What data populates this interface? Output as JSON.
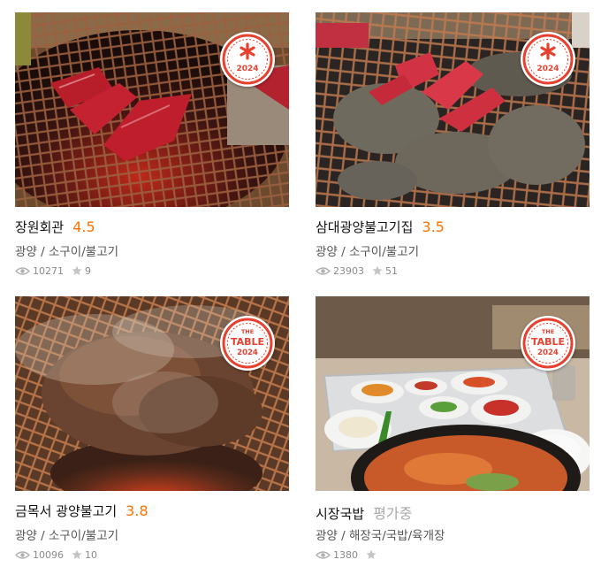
{
  "restaurants": [
    {
      "name": "장원회관",
      "rating": "4.5",
      "category": "광양 / 소구이/불고기",
      "views": "10271",
      "favorites": "9",
      "badge_text": "2024",
      "badge_icon": "asterisk-icon"
    },
    {
      "name": "삼대광양불고기집",
      "rating": "3.5",
      "category": "광양 / 소구이/불고기",
      "views": "23903",
      "favorites": "51",
      "badge_text": "2024",
      "badge_icon": "asterisk-icon"
    },
    {
      "name": "금목서 광양불고기",
      "rating": "3.8",
      "category": "광양 / 소구이/불고기",
      "views": "10096",
      "favorites": "10",
      "badge_top": "THE",
      "badge_main": "TABLE",
      "badge_year": "2024"
    },
    {
      "name": "시장국밥",
      "rating": "평가중",
      "category": "광양 / 해장국/국밥/육개장",
      "views": "1380",
      "favorites": "",
      "badge_top": "THE",
      "badge_main": "TABLE",
      "badge_year": "2024"
    }
  ],
  "colors": {
    "rating": "#ff7100",
    "rating_pending": "#a9a9a9",
    "badge": "#e8402f"
  },
  "icons": {
    "views": "eye-icon",
    "favorites": "star-icon"
  }
}
